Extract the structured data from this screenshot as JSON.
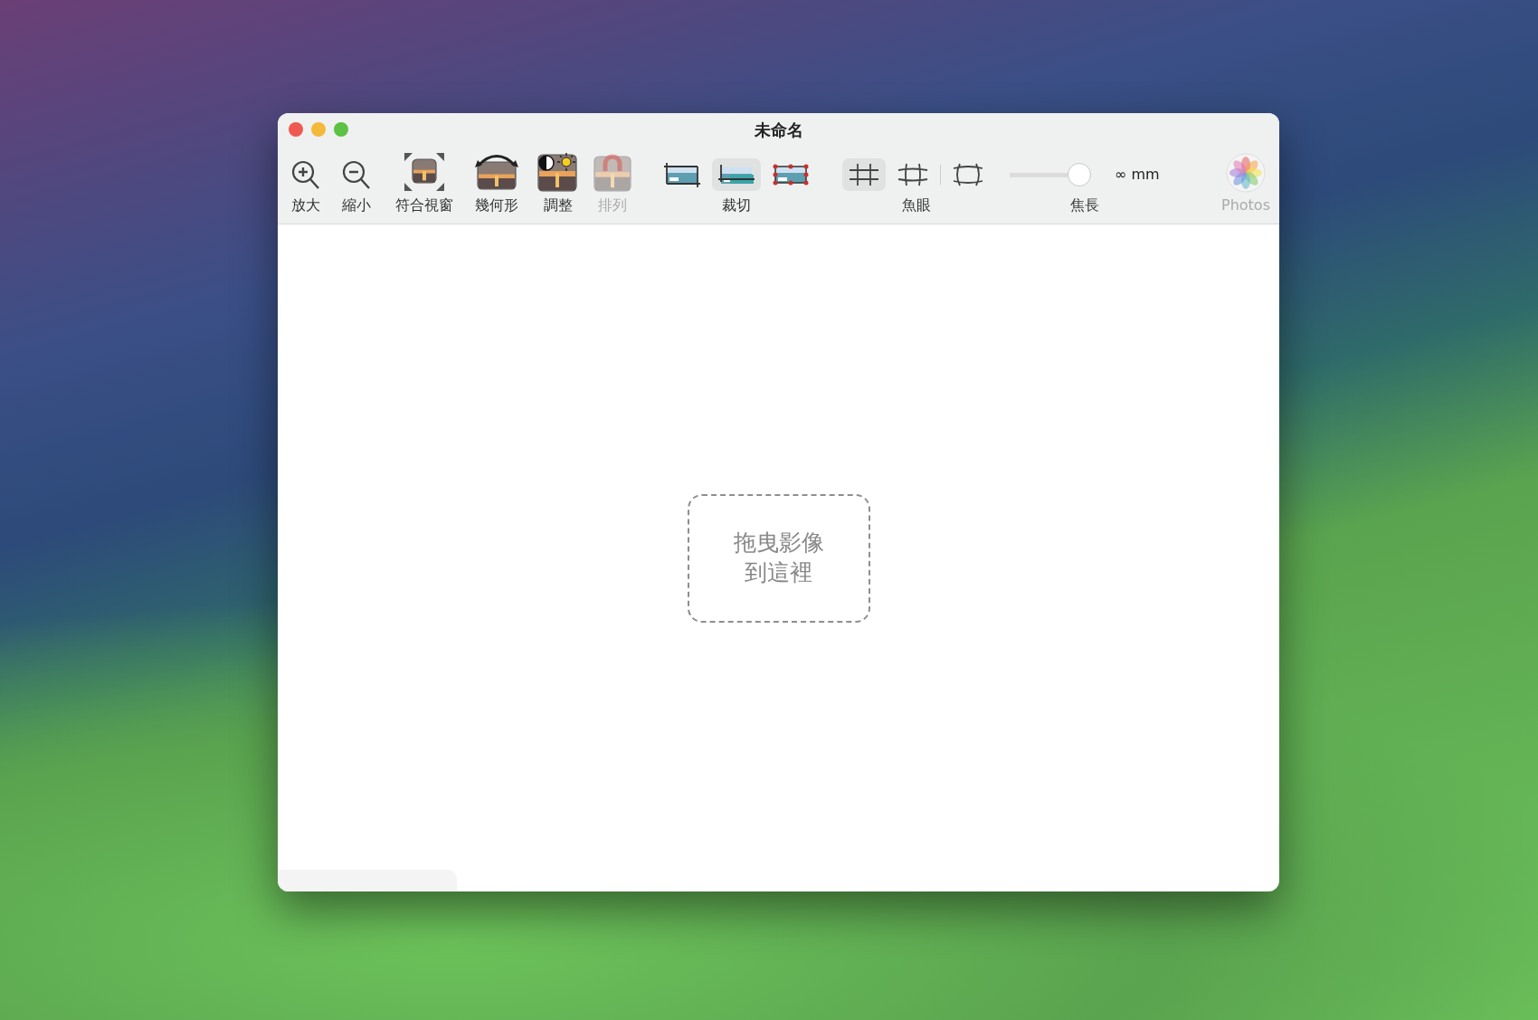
{
  "window": {
    "title": "未命名"
  },
  "toolbar": [
    {
      "kind": "button",
      "label": "放大",
      "disabled": false
    },
    {
      "kind": "button",
      "label": "縮小",
      "disabled": false
    },
    {
      "kind": "button",
      "label": "符合視窗",
      "disabled": false
    },
    {
      "kind": "button",
      "label": "幾何形",
      "disabled": false
    },
    {
      "kind": "button",
      "label": "調整",
      "disabled": false
    },
    {
      "kind": "button",
      "label": "排列",
      "disabled": true
    },
    {
      "kind": "segmented",
      "label": "裁切",
      "options": [
        {
          "selected": false
        },
        {
          "selected": true
        },
        {
          "selected": false
        }
      ]
    },
    {
      "kind": "segmented",
      "label": "魚眼",
      "options": [
        {
          "selected": true
        },
        {
          "selected": false
        },
        {
          "selected": false
        }
      ]
    },
    {
      "kind": "slider",
      "label": "焦長",
      "level": 1,
      "reading": "∞ mm"
    },
    {
      "kind": "button",
      "label": "Photos",
      "disabled": true
    }
  ],
  "drop_zone": {
    "lines": [
      "拖曳影像",
      "到這裡"
    ]
  }
}
